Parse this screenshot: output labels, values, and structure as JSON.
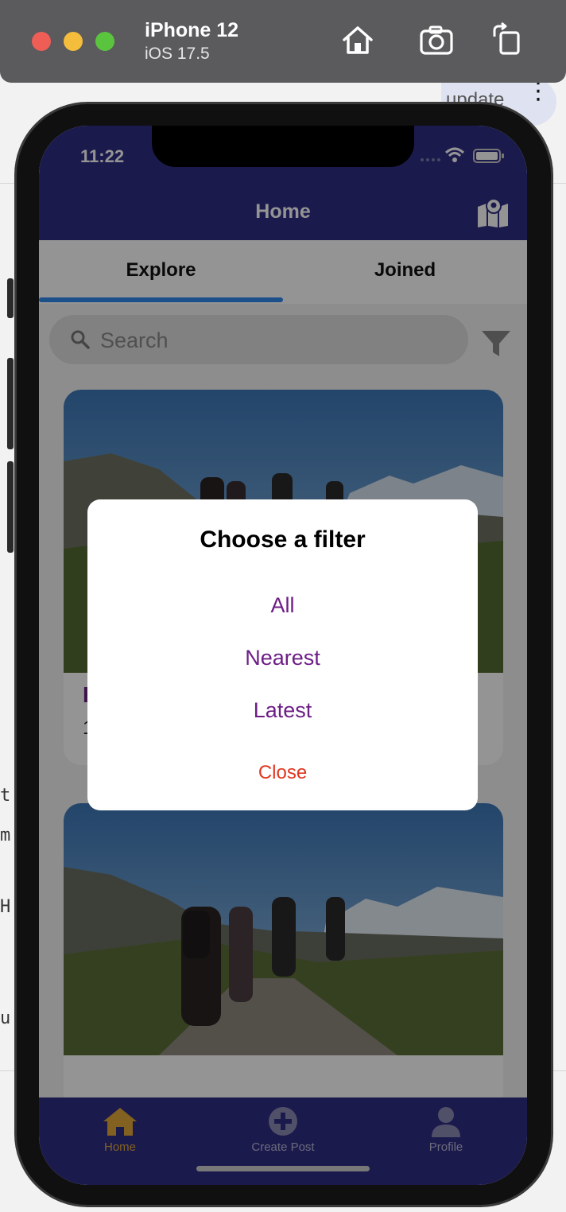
{
  "simulator": {
    "device_name": "iPhone 12",
    "os_version": "iOS 17.5",
    "icons": [
      "home-icon",
      "screenshot-icon",
      "rotate-icon"
    ]
  },
  "background_window": {
    "update_label": "update",
    "mono_lines": [
      "t",
      "m",
      "H",
      "u"
    ]
  },
  "status_bar": {
    "time": "11:22"
  },
  "nav": {
    "title": "Home",
    "right_icon": "map-icon"
  },
  "tabs": [
    {
      "label": "Explore",
      "active": true
    },
    {
      "label": "Joined",
      "active": false
    }
  ],
  "search": {
    "placeholder": "Search",
    "value": ""
  },
  "colors": {
    "primary": "#2f2e86",
    "accent_tab": "#2f8bf0",
    "option_text": "#6d1d86",
    "close_text": "#e0361f",
    "active_bottom_tab": "#e2a73a"
  },
  "feed": {
    "cards": [
      {
        "title": "H",
        "meta": "1"
      },
      {
        "title": "",
        "meta": ""
      }
    ]
  },
  "bottom_nav": [
    {
      "label": "Home",
      "icon": "home-icon",
      "active": true
    },
    {
      "label": "Create Post",
      "icon": "plus-circle-icon",
      "active": false
    },
    {
      "label": "Profile",
      "icon": "person-icon",
      "active": false
    }
  ],
  "modal": {
    "title": "Choose a filter",
    "options": [
      "All",
      "Nearest",
      "Latest"
    ],
    "close_label": "Close"
  }
}
